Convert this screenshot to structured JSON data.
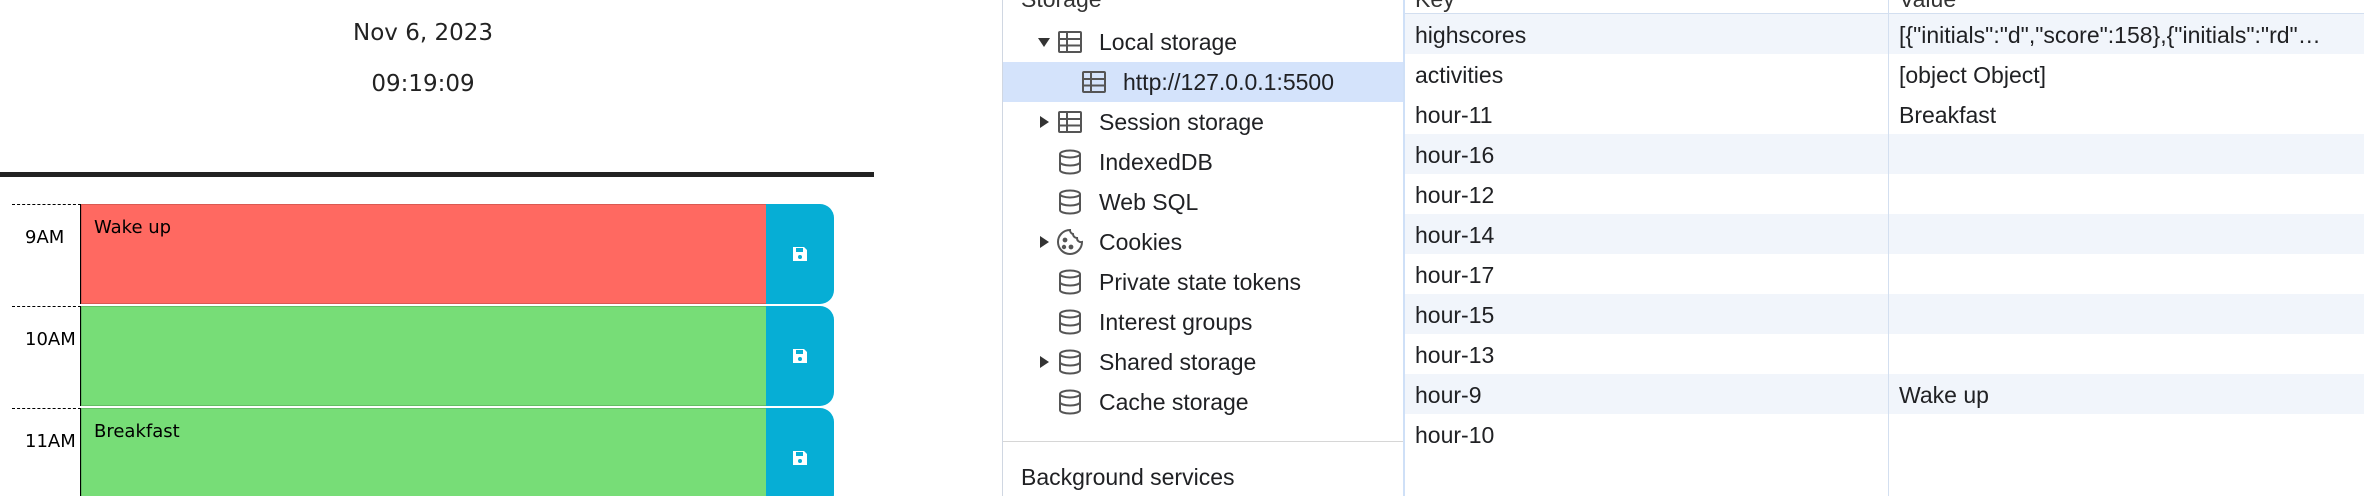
{
  "planner": {
    "date": "Nov 6, 2023",
    "time": "09:19:09",
    "rows": [
      {
        "hour": "9AM",
        "text": "Wake up",
        "state": "past"
      },
      {
        "hour": "10AM",
        "text": "",
        "state": "future"
      },
      {
        "hour": "11AM",
        "text": "Breakfast",
        "state": "future"
      }
    ],
    "save_icon": "floppy-disk-icon",
    "colors": {
      "past": "#ff6961",
      "future": "#77dd77",
      "save": "#06aed5"
    }
  },
  "devtools": {
    "section_heading": "Storage",
    "tree": {
      "local_storage": "Local storage",
      "local_origin": "http://127.0.0.1:5500",
      "session_storage": "Session storage",
      "indexeddb": "IndexedDB",
      "web_sql": "Web SQL",
      "cookies": "Cookies",
      "private_state_tokens": "Private state tokens",
      "interest_groups": "Interest groups",
      "shared_storage": "Shared storage",
      "cache_storage": "Cache storage",
      "background_services": "Background services"
    },
    "table": {
      "key_header": "Key",
      "value_header": "Value",
      "rows": [
        {
          "key": "highscores",
          "value": "[{\"initials\":\"d\",\"score\":158},{\"initials\":\"rd\"…"
        },
        {
          "key": "activities",
          "value": "[object Object]"
        },
        {
          "key": "hour-11",
          "value": "Breakfast"
        },
        {
          "key": "hour-16",
          "value": ""
        },
        {
          "key": "hour-12",
          "value": ""
        },
        {
          "key": "hour-14",
          "value": ""
        },
        {
          "key": "hour-17",
          "value": ""
        },
        {
          "key": "hour-15",
          "value": ""
        },
        {
          "key": "hour-13",
          "value": ""
        },
        {
          "key": "hour-9",
          "value": "Wake up"
        },
        {
          "key": "hour-10",
          "value": ""
        }
      ]
    },
    "colors": {
      "selected": "#d4e3fb",
      "alt_row": "#f1f5fb"
    }
  }
}
